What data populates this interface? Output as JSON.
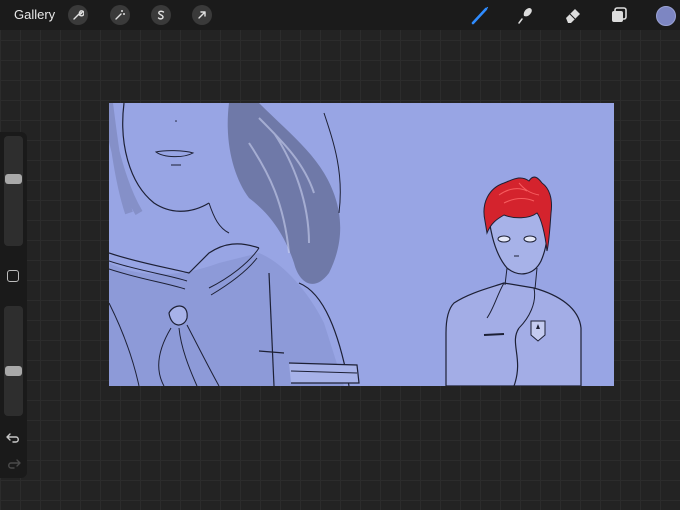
{
  "topbar": {
    "gallery_label": "Gallery",
    "left_tools": [
      "wrench-icon",
      "magic-wand-icon",
      "selection-icon",
      "transform-arrow-icon"
    ],
    "right_tools": [
      "brush-icon",
      "smudge-icon",
      "eraser-icon",
      "layers-icon"
    ],
    "active_tool": "brush-icon",
    "current_color": "#7d86c2"
  },
  "sidebar": {
    "brush_size_level": 0.62,
    "opacity_level": 0.4,
    "buttons": [
      "modify-square-icon",
      "undo-icon",
      "redo-icon"
    ]
  },
  "canvas": {
    "background_color": "#98a5e4",
    "hair_color": "#d4232d"
  }
}
